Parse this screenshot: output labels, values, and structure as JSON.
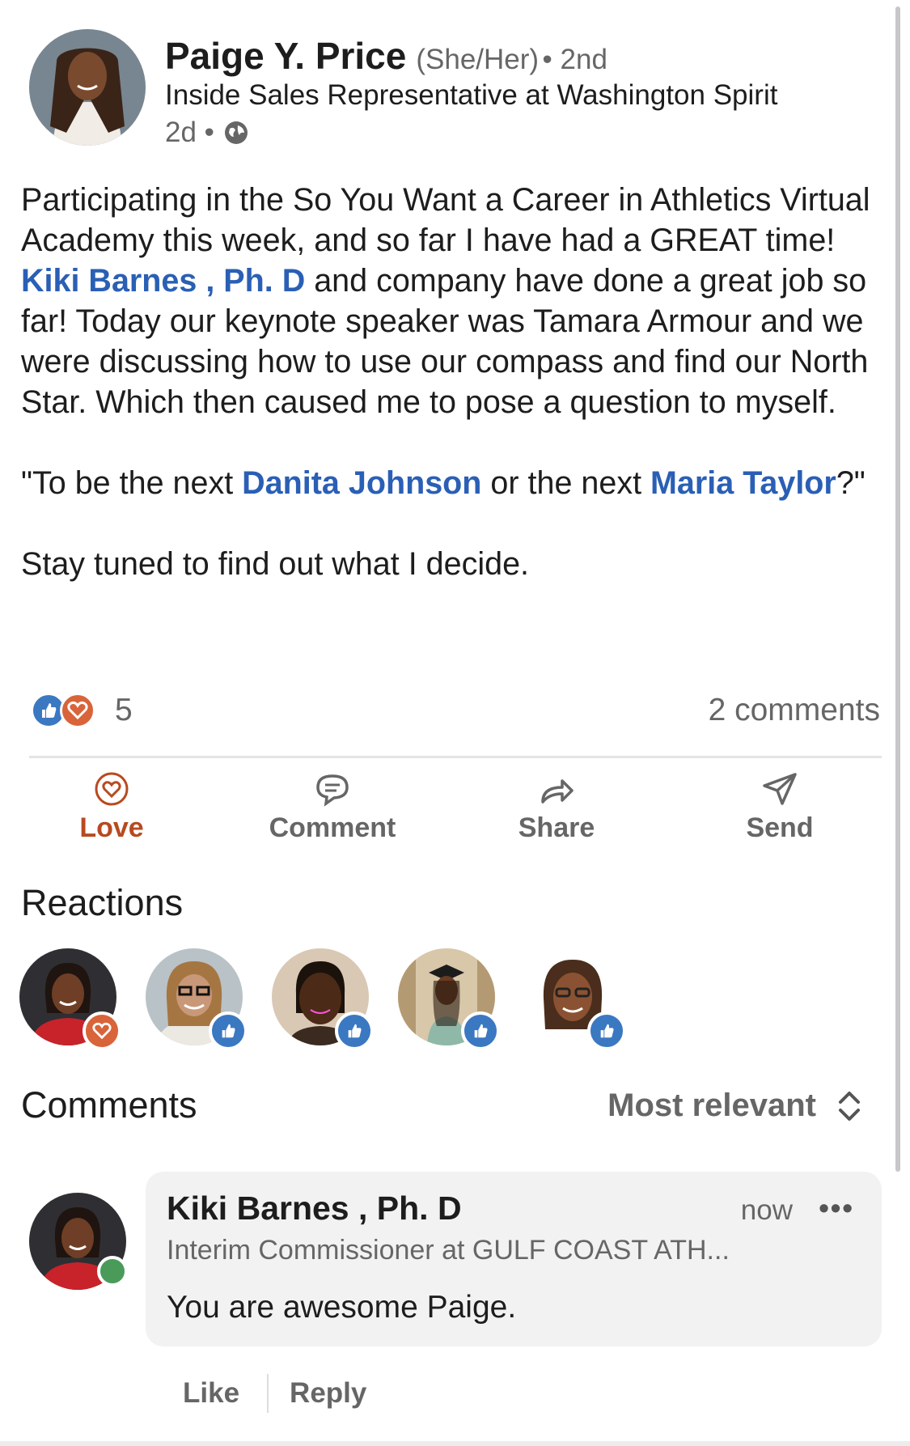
{
  "post": {
    "author": {
      "name": "Paige Y. Price",
      "pronouns": "(She/Her)",
      "degree": "• 2nd",
      "headline": "Inside Sales Representative at Washington Spirit",
      "time": "2d •",
      "visibility_icon": "globe-icon"
    },
    "body": {
      "p1_a": "Participating in the So You Want a Career in Athletics Virtual Academy this week, and so far I have had a GREAT time! ",
      "p1_link": "Kiki Barnes , Ph. D",
      "p1_b": " and company have done a great job so far! Today our keynote speaker was Tamara Armour and we were discussing how to use our compass and find our North Star. Which then caused me to pose a question to myself.",
      "p2_a": "\"To be the next ",
      "p2_link1": "Danita Johnson",
      "p2_b": " or the next ",
      "p2_link2": "Maria Taylor",
      "p2_c": "?\"",
      "p3": "Stay tuned to find out what I decide."
    },
    "reactions_count": "5",
    "comments_count": "2 comments",
    "reaction_icons": [
      "like-icon",
      "love-icon"
    ]
  },
  "actions": {
    "love": "Love",
    "comment": "Comment",
    "share": "Share",
    "send": "Send"
  },
  "reactions_section": {
    "title": "Reactions",
    "reactors": [
      {
        "badge": "love"
      },
      {
        "badge": "like"
      },
      {
        "badge": "like"
      },
      {
        "badge": "like"
      },
      {
        "badge": "like"
      }
    ]
  },
  "comments_section": {
    "title": "Comments",
    "sort": "Most relevant",
    "comments": [
      {
        "name": "Kiki Barnes , Ph. D",
        "headline": "Interim Commissioner at GULF COAST ATH...",
        "time": "now",
        "more": "•••",
        "text": "You are awesome Paige.",
        "like": "Like",
        "reply": "Reply"
      }
    ]
  },
  "colors": {
    "link": "#2a5fb5",
    "love": "#d9643a",
    "like": "#3b78c2",
    "online": "#4a9b5a"
  }
}
